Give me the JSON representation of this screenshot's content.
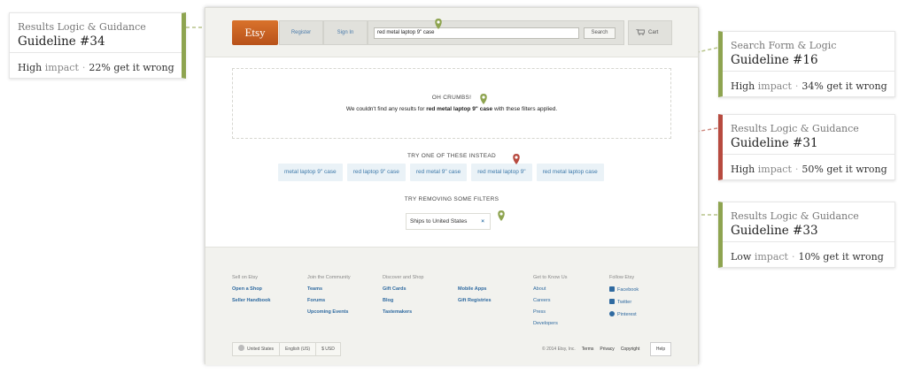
{
  "header": {
    "logo": "Etsy",
    "register": "Register",
    "signin": "Sign In",
    "search_value": "red metal laptop 9\" case",
    "search_button": "Search",
    "cart": "Cart"
  },
  "no_results": {
    "title": "OH CRUMBS!",
    "text_before": "We couldn't find any results for ",
    "query": "red metal laptop 9\" case",
    "text_after": " with these filters applied."
  },
  "try_instead": {
    "title": "TRY ONE OF THESE INSTEAD",
    "items": [
      "metal laptop 9\" case",
      "red laptop 9\" case",
      "red metal 9\" case",
      "red metal laptop 9\"",
      "red metal laptop case"
    ]
  },
  "remove_filters": {
    "title": "TRY REMOVING SOME FILTERS",
    "filter": "Ships to United States",
    "remove_glyph": "×"
  },
  "footer": {
    "columns": [
      {
        "heading": "Sell on Etsy",
        "links": [
          "Open a Shop",
          "Seller Handbook"
        ]
      },
      {
        "heading": "Join the Community",
        "links": [
          "Teams",
          "Forums",
          "Upcoming Events"
        ]
      },
      {
        "heading": "Discover and Shop",
        "links": [
          "Gift Cards",
          "Blog",
          "Tastemakers"
        ]
      },
      {
        "heading": "",
        "links": [
          "Mobile Apps",
          "Gift Registries"
        ]
      },
      {
        "heading": "Get to Know Us",
        "links": [
          "About",
          "Careers",
          "Press",
          "Developers"
        ]
      },
      {
        "heading": "Follow Etsy",
        "links": [
          "Facebook",
          "Twitter",
          "Pinterest"
        ]
      }
    ],
    "locale": {
      "country": "United States",
      "language": "English (US)",
      "currency": "$ USD"
    },
    "copyright": "© 2014 Etsy, Inc.",
    "terms": "Terms",
    "privacy": "Privacy",
    "copyright_link": "Copyright",
    "help": "Help"
  },
  "annotations": [
    {
      "category": "Results Logic & Guidance",
      "guideline": "Guideline #34",
      "impact": "High",
      "impact_label": "impact",
      "stat": "22% get it wrong",
      "color": "#8ea450"
    },
    {
      "category": "Search Form & Logic",
      "guideline": "Guideline #16",
      "impact": "High",
      "impact_label": "impact",
      "stat": "34% get it wrong",
      "color": "#8ea450"
    },
    {
      "category": "Results Logic & Guidance",
      "guideline": "Guideline #31",
      "impact": "High",
      "impact_label": "impact",
      "stat": "50% get it wrong",
      "color": "#b74a3f"
    },
    {
      "category": "Results Logic & Guidance",
      "guideline": "Guideline #33",
      "impact": "Low",
      "impact_label": "impact",
      "stat": "10% get it wrong",
      "color": "#8ea450"
    }
  ],
  "colors": {
    "accent_green": "#8ea450",
    "accent_red": "#b74a3f",
    "link_blue": "#2f6aa0",
    "etsy_orange": "#d9722b"
  }
}
